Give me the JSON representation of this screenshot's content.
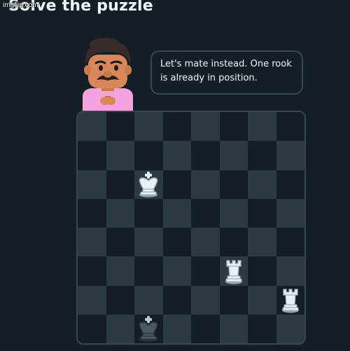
{
  "watermark": "imgflip.com",
  "title": "Solve the puzzle",
  "character": {
    "icon": "tutor-character-icon"
  },
  "speech": {
    "text": "Let's mate instead. One rook is already in position."
  },
  "board": {
    "light_color": "#2c3a41",
    "dark_color": "#131f24",
    "light_on_top_left": true,
    "pieces": [
      {
        "type": "king",
        "color": "white",
        "square": "c6"
      },
      {
        "type": "rook",
        "color": "white",
        "square": "f3"
      },
      {
        "type": "rook",
        "color": "white",
        "square": "h2"
      },
      {
        "type": "king",
        "color": "black",
        "square": "c1"
      }
    ]
  }
}
